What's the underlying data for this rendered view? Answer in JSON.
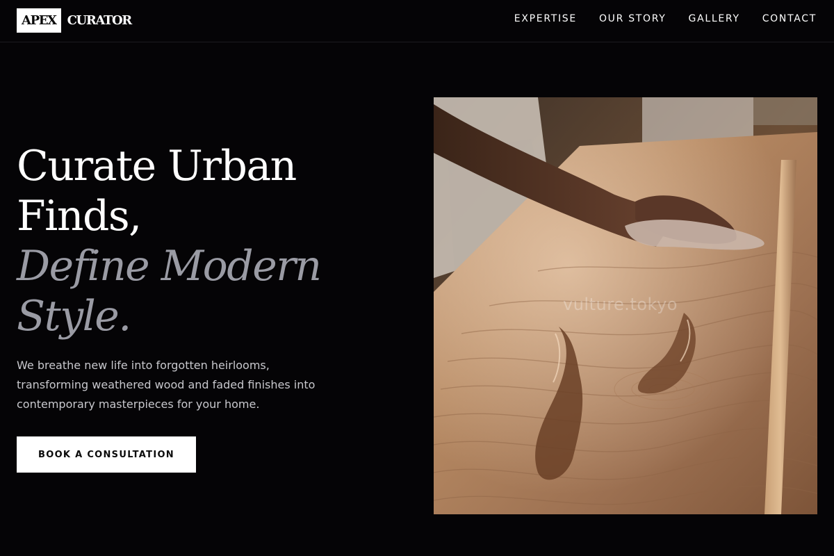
{
  "header": {
    "logo_box": "APEX",
    "logo_text": "CURATOR",
    "nav": [
      {
        "label": "EXPERTISE"
      },
      {
        "label": "OUR STORY"
      },
      {
        "label": "GALLERY"
      },
      {
        "label": "CONTACT"
      }
    ]
  },
  "hero": {
    "title_lines": [
      "Curate Urban",
      "Finds,"
    ],
    "accent_lines": [
      "Define Modern",
      "Style."
    ],
    "description": "We breathe new life into forgotten heirlooms, transforming weathered wood and faded finishes into contemporary masterpieces for your home.",
    "cta_label": "BOOK A CONSULTATION",
    "image": {
      "watermark": "vulture.tokyo",
      "alt": "hand-wiping-wood-finish"
    }
  },
  "colors": {
    "background": "#050406",
    "accent_muted": "#9a9ba4",
    "text_body": "#c8c8cd",
    "button_bg": "#ffffff"
  }
}
